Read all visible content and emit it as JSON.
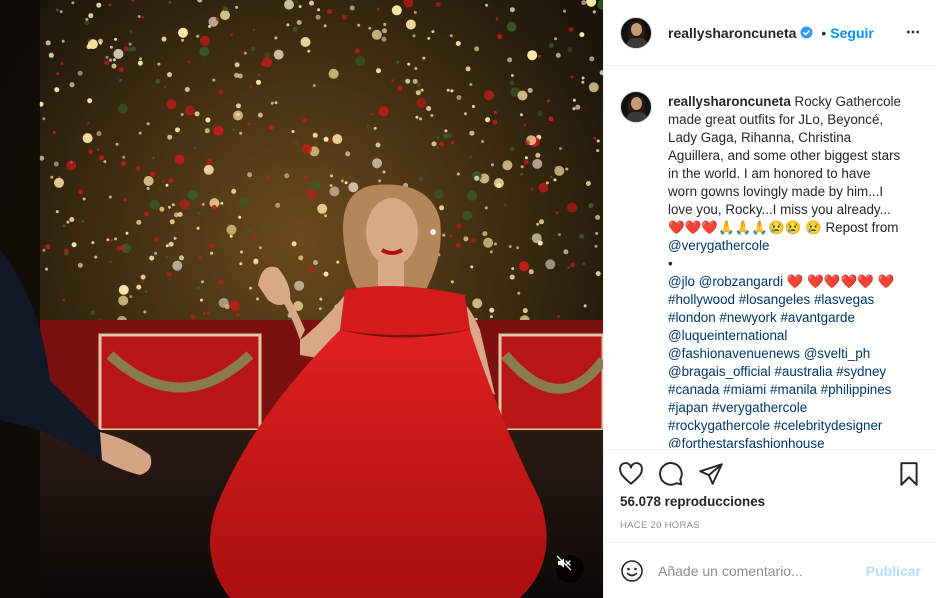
{
  "post": {
    "username": "reallysharoncuneta",
    "follow_label": "Seguir",
    "separator": "•",
    "caption_username": "reallysharoncuneta",
    "caption_body": " Rocky Gathercole made great outfits for JLo, Beyoncé, Lady Gaga, Rihanna, Christina Aguillera, and some other biggest stars in the world. I am honored to have worn gowns lovingly made by him...I love you, Rocky...I miss you already...❤️❤️❤️🙏🙏🙏😢😢 😢 Repost from ",
    "repost_mention": "@verygathercole",
    "caption_dot": "•",
    "mentions_line": [
      "@jlo",
      "@robzangardi"
    ],
    "hearts_line": " ❤️ ❤️❤️❤️❤️ ❤️ ",
    "hashtags": [
      "#hollywood",
      "#losangeles",
      "#lasvegas",
      "#london",
      "#newyork",
      "#avantgarde",
      "@luqueinternational",
      "@fashionavenuenews",
      "@svelti_ph",
      "@bragais_official",
      "#australia",
      "#sydney",
      "#canada",
      "#miami",
      "#manila",
      "#philippines",
      "#japan",
      "#verygathercole",
      "#rockygathercole",
      "#celebritydesigner",
      "@forthestarsfashionhouse"
    ],
    "views": "56.078 reproducciones",
    "time_ago": "HACE 20 HORAS",
    "comment_placeholder": "Añade un comentario...",
    "publish_label": "Publicar"
  },
  "icons": {
    "verified": "verified-badge-icon",
    "more": "more-options-icon",
    "like": "heart-icon",
    "comment": "comment-icon",
    "share": "share-icon",
    "save": "bookmark-icon",
    "emoji": "emoji-icon",
    "mute": "muted-speaker-icon"
  },
  "colors": {
    "link_blue": "#0095f6",
    "hashtag": "#00376b",
    "dress_red": "#d41a1a",
    "publish_disabled": "#b3dffc"
  }
}
